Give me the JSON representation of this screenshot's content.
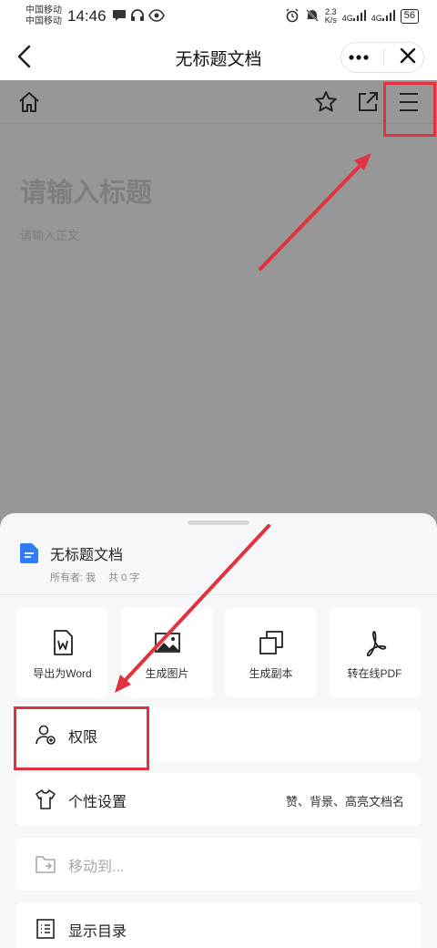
{
  "status_bar": {
    "carrier_1": "中国移动",
    "carrier_2": "中国移动",
    "time": "14:46",
    "net_speed_value": "2.3",
    "net_speed_unit": "K/s",
    "network_1": "4G",
    "network_2": "4G",
    "battery": "56"
  },
  "title_bar": {
    "title": "无标题文档",
    "more_icon": "more-dots-icon",
    "close_icon": "close-icon"
  },
  "editor": {
    "title_placeholder": "请输入标题",
    "body_placeholder": "请输入正文",
    "toolbar_icons": [
      "home-icon",
      "star-icon",
      "share-external-icon",
      "hamburger-menu-icon"
    ]
  },
  "sheet": {
    "doc_name": "无标题文档",
    "owner_text": "所有者: 我",
    "count_text": "共 0 字",
    "actions": [
      {
        "label": "导出为Word",
        "icon": "word-export-icon"
      },
      {
        "label": "生成图片",
        "icon": "image-icon"
      },
      {
        "label": "生成副本",
        "icon": "copy-icon"
      },
      {
        "label": "转在线PDF",
        "icon": "pdf-icon"
      }
    ],
    "menu": [
      {
        "label": "权限",
        "icon": "user-permission-icon",
        "hint": ""
      },
      {
        "label": "个性设置",
        "icon": "shirt-icon",
        "hint": "赞、背景、高亮文档名"
      },
      {
        "label": "移动到...",
        "icon": "folder-move-icon",
        "hint": ""
      },
      {
        "label": "显示目录",
        "icon": "toc-list-icon",
        "hint": ""
      }
    ]
  },
  "colors": {
    "annotation_red": "#e0333f",
    "dim_overlay": "#979797",
    "sheet_bg": "#f6f7f9",
    "doc_icon_blue": "#2f7cf6"
  }
}
